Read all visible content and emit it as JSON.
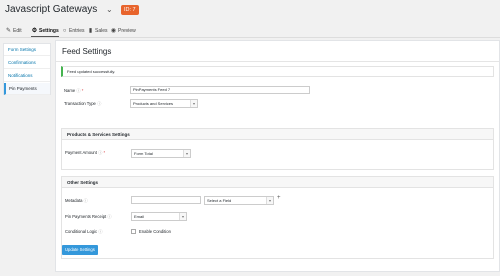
{
  "header": {
    "form_title": "Javascript Gateways",
    "form_id_badge": "ID: 7"
  },
  "tabs": [
    {
      "label": "Edit",
      "icon": "pencil-icon"
    },
    {
      "label": "Settings",
      "icon": "gear-icon",
      "active": true
    },
    {
      "label": "Entries",
      "icon": "comment-icon"
    },
    {
      "label": "Sales",
      "icon": "bar-chart-icon"
    },
    {
      "label": "Preview",
      "icon": "eye-icon"
    }
  ],
  "sidebar": {
    "items": [
      {
        "label": "Form Settings"
      },
      {
        "label": "Confirmations"
      },
      {
        "label": "Notifications"
      },
      {
        "label": "Pin Payments",
        "active": true
      }
    ]
  },
  "main": {
    "title": "Feed Settings",
    "notice": "Feed updated successfully.",
    "name": {
      "label": "Name",
      "value": "PinPayments Feed 7"
    },
    "transaction_type": {
      "label": "Transaction Type",
      "value": "Products and Services"
    },
    "products_services": {
      "heading": "Products & Services Settings",
      "payment_amount": {
        "label": "Payment Amount",
        "value": "Form Total"
      }
    },
    "other_settings": {
      "heading": "Other Settings",
      "metadata": {
        "label": "Metadata",
        "key_value": "",
        "field_select": "Select a Field"
      },
      "receipt": {
        "label": "Pin Payments Receipt",
        "value": "Email"
      },
      "conditional_logic": {
        "label": "Conditional Logic",
        "checkbox_label": "Enable Condition"
      }
    },
    "update_button": "Update Settings"
  },
  "colors": {
    "accent": "#3498db",
    "badge": "#e8642c",
    "success": "#46b450",
    "link": "#0073aa"
  }
}
